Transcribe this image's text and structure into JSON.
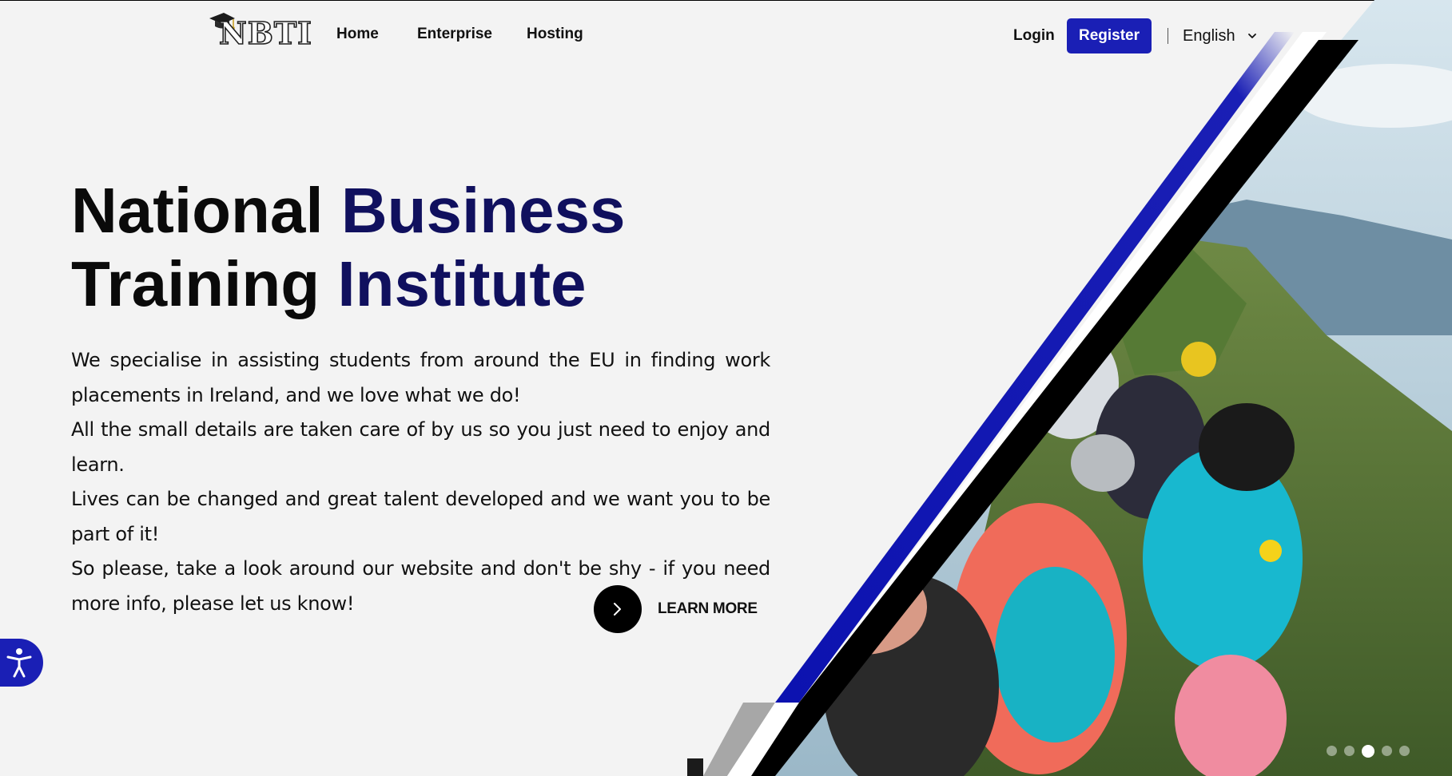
{
  "header": {
    "logo_text": "NBTI",
    "nav": [
      "Home",
      "Enterprise",
      "Hosting"
    ],
    "login_label": "Login",
    "register_label": "Register",
    "language": "English",
    "language_chevron_icon": "chevron-down-icon"
  },
  "hero": {
    "title_part1": "National",
    "title_part2": "Business",
    "title_part3": "Training",
    "title_part4": "Institute",
    "paragraphs": [
      "We specialise in assisting students from around the EU in finding work placements in Ireland, and we love what we do!",
      "All the small details are taken care of by us so you just need to enjoy and learn.",
      "Lives can be changed and great talent developed and we want you to be part of it!",
      "So please, take a look around our website and don't be shy - if you need more info, please let us know!"
    ],
    "learn_more_label": "LEARN MORE",
    "learn_more_icon": "chevron-right-icon",
    "image_subject": "hikers-with-backpacks-on-mountain-trail"
  },
  "carousel": {
    "slides": 5,
    "active_index": 2
  },
  "accessibility_icon": "accessibility-icon",
  "colors": {
    "brand_blue": "#1a1fb5",
    "title_dark_blue": "#10105e",
    "background": "#f3f3f3"
  }
}
